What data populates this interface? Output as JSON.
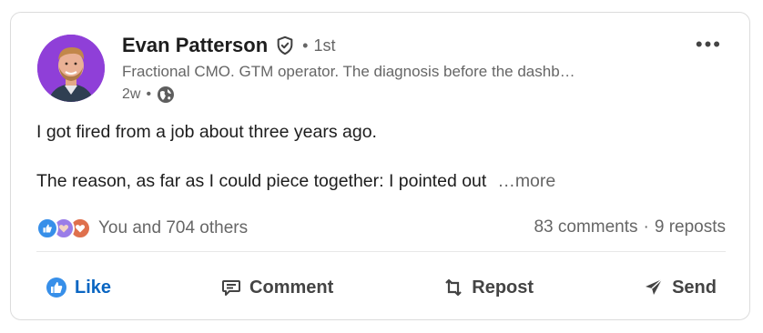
{
  "post": {
    "author_name": "Evan Patterson",
    "connection_degree": "1st",
    "headline": "Fractional CMO. GTM operator. The diagnosis before the dashb…",
    "time_ago": "2w",
    "body_line1": "I got fired from a job about three years ago.",
    "body_line2": "The reason, as far as I could piece together: I pointed out",
    "see_more": "…more"
  },
  "social": {
    "reactions_text": "You and 704 others",
    "comments": "83 comments",
    "reposts": "9 reposts"
  },
  "actions": {
    "like": "Like",
    "comment": "Comment",
    "repost": "Repost",
    "send": "Send"
  },
  "colors": {
    "accent": "#0a66c2",
    "avatar_bg": "#8f3fd8",
    "reaction_like": "#378fe9",
    "reaction_support": "#9a7de8",
    "reaction_love": "#df704d"
  },
  "icons": [
    "verified-shield-icon",
    "globe-icon",
    "more-options-icon",
    "like-icon",
    "comment-icon",
    "repost-icon",
    "send-icon"
  ]
}
